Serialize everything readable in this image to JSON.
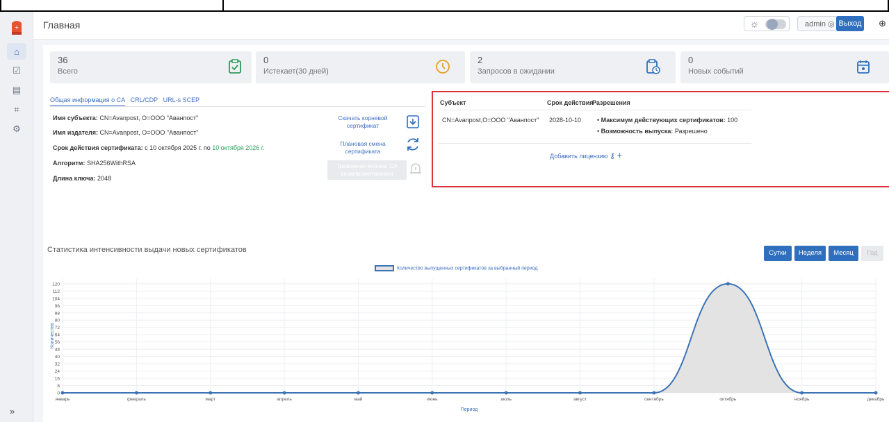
{
  "header": {
    "title": "Главная",
    "user_label": "admin",
    "logout_label": "Выход"
  },
  "stats": [
    {
      "value": "36",
      "label": "Всего"
    },
    {
      "value": "0",
      "label": "Истекает(30 дней)"
    },
    {
      "value": "2",
      "label": "Запросов в ожидании"
    },
    {
      "value": "0",
      "label": "Новых событий"
    }
  ],
  "tabs": [
    "Общая информация о CA",
    "CRL/CDP",
    "URL-s SCEP"
  ],
  "ca_info": {
    "subject_label": "Имя субъекта:",
    "subject_value": "CN=Avanpost, O=ООО \"Аванпост\"",
    "issuer_label": "Имя издателя:",
    "issuer_value": "CN=Avanpost, O=ООО \"Аванпост\"",
    "validity_label": "Срок действия сертификата:",
    "validity_from": "с 10 октября 2025 г.",
    "validity_to_prefix": "по",
    "validity_to": "10 октября 2026 г.",
    "algo_label": "Алгоритм:",
    "algo_value": "SHA256WithRSA",
    "keylen_label": "Длина ключа:",
    "keylen_value": "2048"
  },
  "actions": {
    "download_root": "Скачать корневой сертификат",
    "planned_change": "Плановая смена сертификата",
    "alarm_button": "Тревожная кнопка: CA скомпрометирован"
  },
  "license": {
    "col_subject": "Субъект",
    "col_validity": "Срок действия",
    "col_permissions": "Разрешения",
    "subject": "CN=Avanpost,O=ООО \"Аванпост\"",
    "validity": "2028-10-10",
    "perm1_label": "Максимум действующих сертификатов:",
    "perm1_value": "100",
    "perm2_label": "Возможность выпуска:",
    "perm2_value": "Разрешено",
    "add_label": "Добавить лицензию"
  },
  "chart_section": {
    "title": "Статистика интенсивности выдачи новых сертификатов",
    "period_buttons": [
      "Сутки",
      "Неделя",
      "Месяц",
      "Год"
    ]
  },
  "chart_data": {
    "type": "area",
    "legend": "Количество выпущенных сертификатов за выбранный период",
    "xlabel": "Период",
    "ylabel": "Количество",
    "categories": [
      "январь",
      "февраль",
      "март",
      "апрель",
      "май",
      "июнь",
      "июль",
      "август",
      "сентябрь",
      "октябрь",
      "ноябрь",
      "декабрь"
    ],
    "values": [
      0,
      0,
      0,
      0,
      0,
      0,
      0,
      0,
      0,
      120,
      0,
      0
    ],
    "yticks": [
      0,
      8,
      16,
      24,
      32,
      40,
      48,
      56,
      64,
      72,
      80,
      88,
      96,
      104,
      112,
      120
    ],
    "ylim": [
      0,
      126
    ],
    "grid": true
  },
  "colors": {
    "accent": "#2f6fbd",
    "line": "#3c73b5",
    "license_border": "#d9323a",
    "ok_icon": "#2e9a5b",
    "warn_icon": "#e0a321"
  }
}
